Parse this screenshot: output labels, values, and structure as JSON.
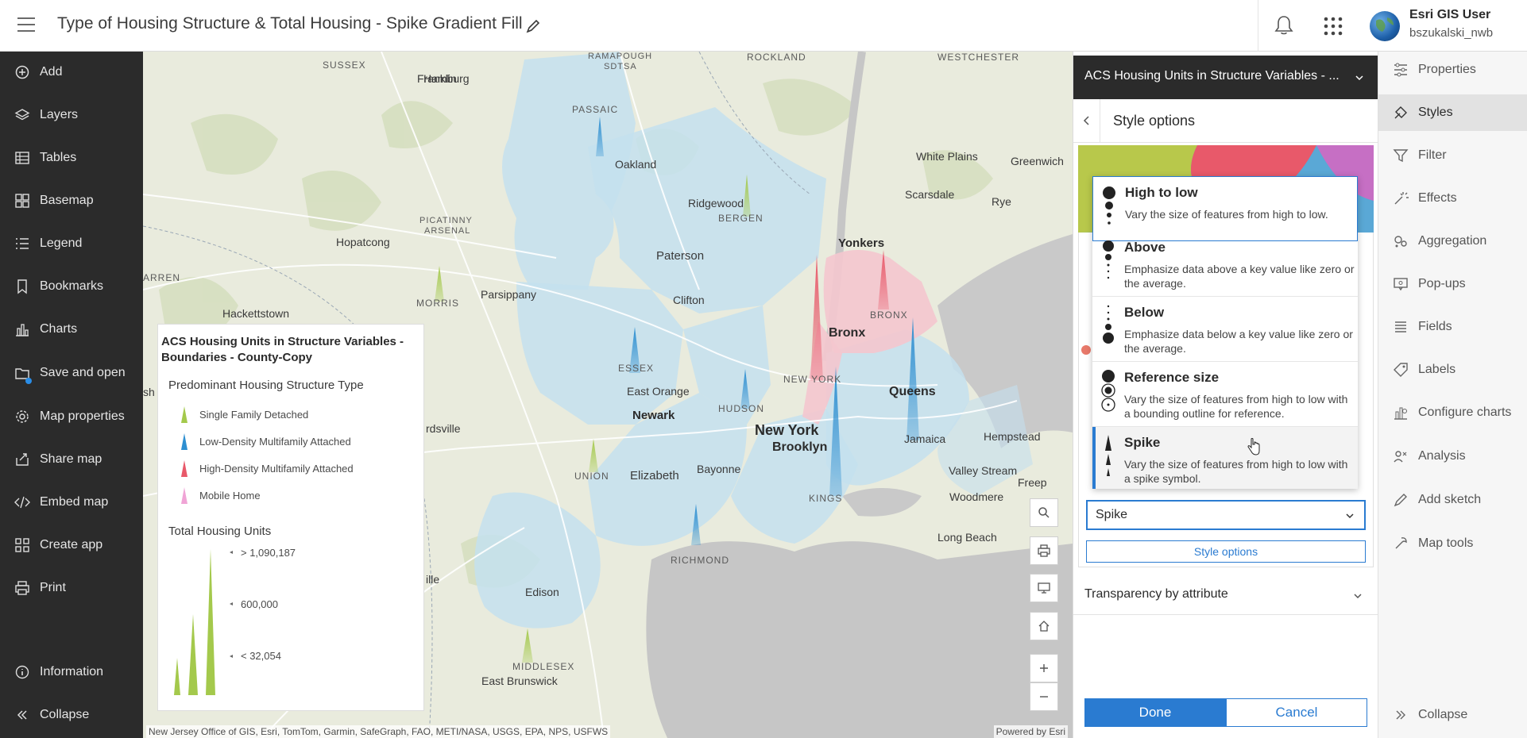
{
  "header": {
    "title": "Type of Housing Structure & Total Housing - Spike Gradient Fill",
    "user_name": "Esri GIS User",
    "user_id": "bszukalski_nwb"
  },
  "left_nav": {
    "items": [
      {
        "label": "Add",
        "icon": "plus-circle-icon"
      },
      {
        "label": "Layers",
        "icon": "layers-icon"
      },
      {
        "label": "Tables",
        "icon": "table-icon"
      },
      {
        "label": "Basemap",
        "icon": "basemap-icon"
      },
      {
        "label": "Legend",
        "icon": "legend-icon"
      },
      {
        "label": "Bookmarks",
        "icon": "bookmark-icon"
      },
      {
        "label": "Charts",
        "icon": "chart-icon"
      },
      {
        "label": "Save and open",
        "icon": "save-icon"
      },
      {
        "label": "Map properties",
        "icon": "gear-icon"
      },
      {
        "label": "Share map",
        "icon": "share-icon"
      },
      {
        "label": "Embed map",
        "icon": "code-icon"
      },
      {
        "label": "Create app",
        "icon": "apps-icon"
      },
      {
        "label": "Print",
        "icon": "print-icon"
      }
    ],
    "information": "Information",
    "collapse": "Collapse"
  },
  "map": {
    "places": {
      "hamburg": "Hamburg",
      "sussex": "SUSSEX",
      "franklin": "Franklin",
      "ramapough": "RAMAPOUGH",
      "sdtsa": "SDTSA",
      "rockland": "ROCKLAND",
      "westchester": "WESTCHESTER",
      "passaic": "PASSAIC",
      "oakland": "Oakland",
      "ridgewood": "Ridgewood",
      "bergen": "BERGEN",
      "white_plains": "White Plains",
      "greenwich": "Greenwich",
      "picatinny": "PICATINNY",
      "arsenal": "ARSENAL",
      "scarsdale": "Scarsdale",
      "rye": "Rye",
      "hopatcong": "Hopatcong",
      "yonkers": "Yonkers",
      "paterson": "Paterson",
      "warren": "ARREN",
      "morris": "MORRIS",
      "parsippany": "Parsippany",
      "hackettstown": "Hackettstown",
      "clifton": "Clifton",
      "bronx_cap": "BRONX",
      "bronx": "Bronx",
      "new_york_cap": "NEW YORK",
      "essex": "ESSEX",
      "east_orange": "East Orange",
      "queens": "Queens",
      "hudson": "HUDSON",
      "newark": "Newark",
      "hempstead": "Hempstead",
      "new_york": "New York",
      "brooklyn": "Brooklyn",
      "jamaica": "Jamaica",
      "union": "UNION",
      "elizabeth": "Elizabeth",
      "bayonne": "Bayonne",
      "valley_stream": "Valley Stream",
      "freeport": "Freep",
      "woodmere": "Woodmere",
      "kings": "KINGS",
      "long_beach": "Long Beach",
      "richmond": "RICHMOND",
      "edison": "Edison",
      "middlesex": "MIDDLESEX",
      "east_brunswick": "East Brunswick",
      "ille": "ille",
      "rdsville": "rdsville",
      "sh": "sh"
    },
    "attribution": "New Jersey Office of GIS, Esri, TomTom, Garmin, SafeGraph, FAO, METI/NASA, USGS, EPA, NPS, USFWS",
    "powered_by": "Powered by Esri"
  },
  "legend": {
    "title": "ACS Housing Units in Structure Variables - Boundaries - County-Copy",
    "predominant_title": "Predominant Housing Structure Type",
    "items": [
      {
        "label": "Single Family Detached",
        "color": "#a4c94c"
      },
      {
        "label": "Low-Density Multifamily Attached",
        "color": "#2e8fd1"
      },
      {
        "label": "High-Density Multifamily Attached",
        "color": "#e8596a"
      },
      {
        "label": "Mobile Home",
        "color": "#f0a4d6"
      }
    ],
    "size_title": "Total Housing Units",
    "size_labels": [
      "> 1,090,187",
      "600,000",
      "< 32,054"
    ]
  },
  "panel": {
    "layer_title": "ACS Housing Units in Structure Variables - ...",
    "style_options_title": "Style options",
    "options": [
      {
        "title": "High to low",
        "desc": "Vary the size of features from high to low."
      },
      {
        "title": "Above",
        "desc": "Emphasize data above a key value like zero or the average."
      },
      {
        "title": "Below",
        "desc": "Emphasize data below a key value like zero or the average."
      },
      {
        "title": "Reference size",
        "desc": "Vary the size of features from high to low with a bounding outline for reference."
      },
      {
        "title": "Spike",
        "desc": "Vary the size of features from high to low with a spike symbol."
      }
    ],
    "selected_value": "Spike",
    "style_options_button": "Style options",
    "transparency_label": "Transparency by attribute",
    "done": "Done",
    "cancel": "Cancel"
  },
  "right_nav": {
    "items": [
      {
        "label": "Properties",
        "icon": "properties-icon"
      },
      {
        "label": "Styles",
        "icon": "styles-icon"
      },
      {
        "label": "Filter",
        "icon": "filter-icon"
      },
      {
        "label": "Effects",
        "icon": "effects-icon"
      },
      {
        "label": "Aggregation",
        "icon": "aggregation-icon"
      },
      {
        "label": "Pop-ups",
        "icon": "popup-icon"
      },
      {
        "label": "Fields",
        "icon": "fields-icon"
      },
      {
        "label": "Labels",
        "icon": "labels-icon"
      },
      {
        "label": "Configure charts",
        "icon": "configure-charts-icon"
      },
      {
        "label": "Analysis",
        "icon": "analysis-icon"
      },
      {
        "label": "Add sketch",
        "icon": "sketch-icon"
      },
      {
        "label": "Map tools",
        "icon": "map-tools-icon"
      }
    ],
    "active": "Styles",
    "collapse": "Collapse"
  }
}
